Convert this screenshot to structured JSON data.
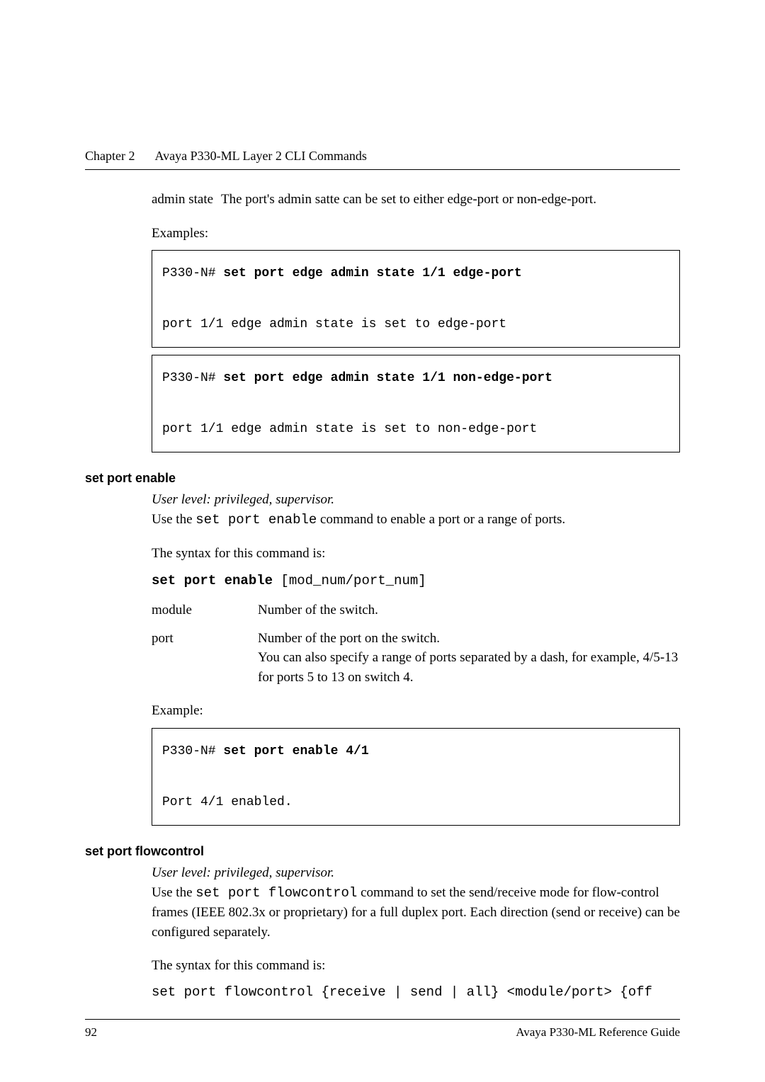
{
  "header": {
    "chapter": "Chapter 2",
    "title": "Avaya P330-ML Layer 2 CLI Commands"
  },
  "admin_state": {
    "label": "admin state",
    "desc": "The port's admin satte can be set to either edge-port or non-edge-port."
  },
  "examples_label": "Examples:",
  "example1": {
    "prompt": "P330-N# ",
    "cmd": "set port edge admin state 1/1 edge-port",
    "output": "port 1/1 edge admin state is set to edge-port"
  },
  "example2": {
    "prompt": "P330-N# ",
    "cmd": "set port edge admin state 1/1 non-edge-port",
    "output": "port 1/1 edge admin state is set to non-edge-port"
  },
  "sections": {
    "enable": {
      "heading": "set port enable",
      "userlevel": "User level: privileged, supervisor.",
      "desc_pre": "Use the ",
      "desc_code": "set port enable",
      "desc_post": " command to enable a port or a range of ports.",
      "syntax_label": "The syntax for this command is:",
      "syntax_cmd": "set port enable",
      "syntax_args": " [mod_num/port_num]",
      "params": {
        "module": {
          "label": "module",
          "desc": "Number of the switch."
        },
        "port": {
          "label": "port",
          "desc": "Number of the port on the switch.\nYou can also specify a range of ports separated by a dash, for example, 4/5-13 for ports 5 to 13 on switch 4."
        }
      },
      "example_label": "Example:",
      "example": {
        "prompt": "P330-N# ",
        "cmd": "set port enable 4/1",
        "output": "Port 4/1 enabled."
      }
    },
    "flowcontrol": {
      "heading": "set port flowcontrol",
      "userlevel": "User level: privileged, supervisor.",
      "desc_pre": "Use the ",
      "desc_code": "set port flowcontrol",
      "desc_post": " command to set the send/receive mode for flow-control frames (IEEE 802.3x or proprietary) for a full duplex port. Each direction (send or receive) can be configured separately.",
      "syntax_label": "The syntax for this command is:",
      "syntax_line": "set port flowcontrol {receive | send | all} <module/port> {off"
    }
  },
  "footer": {
    "page": "92",
    "doc": "Avaya P330-ML Reference Guide"
  }
}
